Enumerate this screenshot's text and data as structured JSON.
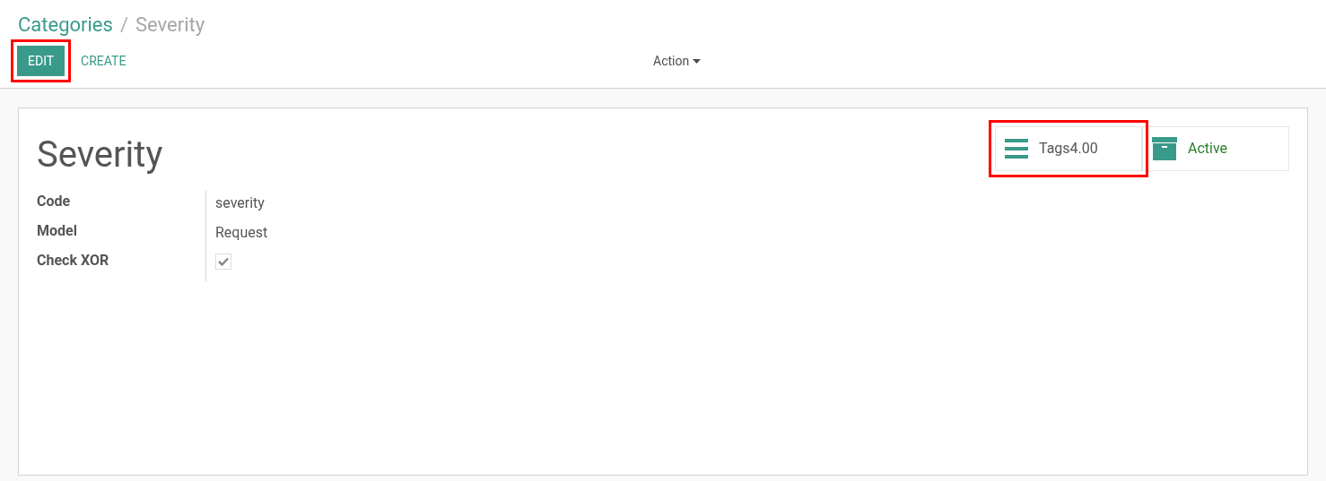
{
  "breadcrumb": {
    "parent": "Categories",
    "separator": "/",
    "current": "Severity"
  },
  "buttons": [
    {
      "label": "EDIT",
      "kind": "primary",
      "highlighted": true
    },
    {
      "label": "CREATE",
      "kind": "link",
      "highlighted": false
    }
  ],
  "action_menu": {
    "label": "Action"
  },
  "record": {
    "title": "Severity",
    "smart_buttons": [
      {
        "kind": "tags",
        "label": "Tags4.00",
        "highlighted": true
      },
      {
        "kind": "archive",
        "label": "Active",
        "highlighted": false
      }
    ],
    "fields": [
      {
        "label": "Code",
        "kind": "text",
        "value": "severity"
      },
      {
        "label": "Model",
        "kind": "text",
        "value": "Request"
      },
      {
        "label": "Check XOR",
        "kind": "checkbox",
        "checked": true
      }
    ]
  }
}
